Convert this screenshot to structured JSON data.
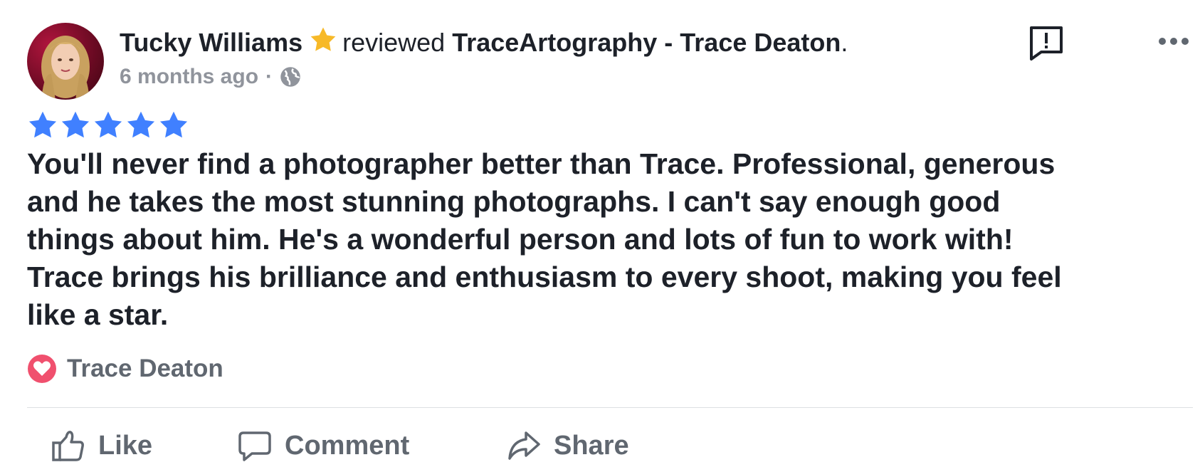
{
  "review": {
    "author": "Tucky Williams",
    "action_text": "reviewed",
    "page_name": "TraceArtography - Trace Deaton",
    "period": ".",
    "timestamp": "6 months ago",
    "separator": "·",
    "audience_icon": "globe-icon",
    "rating": 5,
    "rating_max": 5,
    "text_lines": [
      "You'll never find a photographer better than Trace.  Professional, generous",
      "and he takes the most stunning photographs.  I can't say enough good",
      "things about him.  He's a wonderful person and lots of fun to work with!",
      "Trace brings his brilliance and enthusiasm to every shoot, making you feel",
      "like a star."
    ]
  },
  "reaction": {
    "icon": "heart-icon",
    "name": "Trace Deaton"
  },
  "actions": {
    "like": "Like",
    "comment": "Comment",
    "share": "Share"
  },
  "icons": {
    "report": "report-icon",
    "more": "more-icon",
    "badge": "star-badge-icon"
  },
  "colors": {
    "rating_star": "#4080ff",
    "badge_star": "#f7b928",
    "heart": "#f0506e",
    "text": "#1d2129",
    "secondary": "#90949c",
    "action": "#606770"
  }
}
